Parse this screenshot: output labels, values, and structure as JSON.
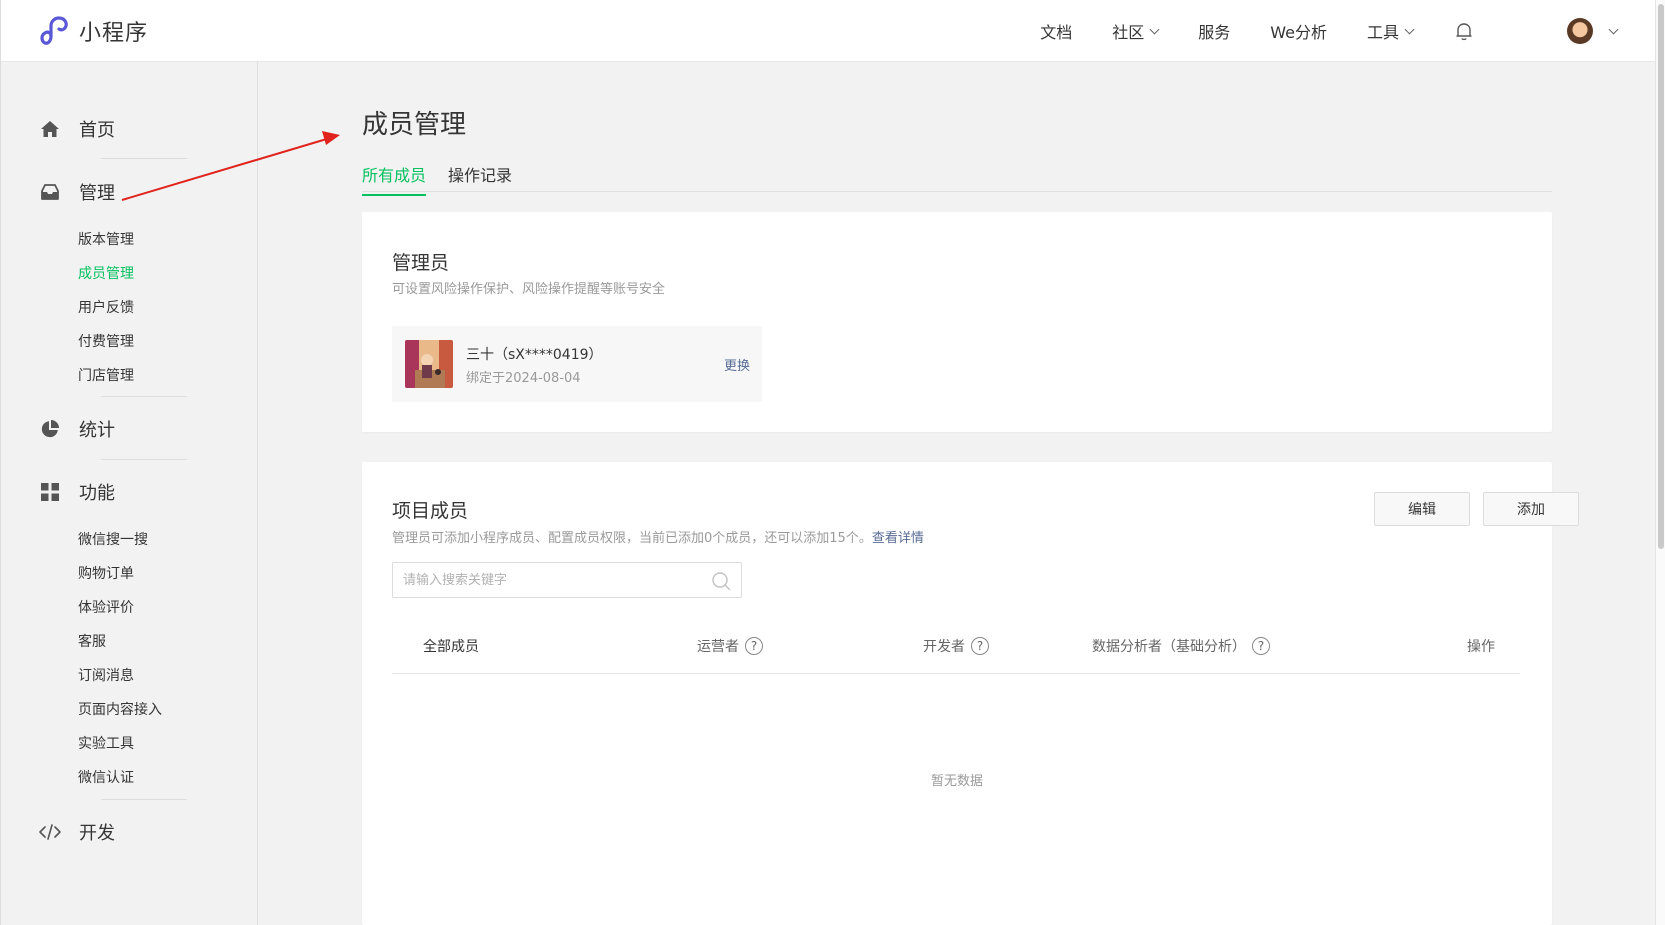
{
  "header": {
    "app_name": "小程序",
    "nav": [
      {
        "label": "文档",
        "dropdown": false
      },
      {
        "label": "社区",
        "dropdown": true
      },
      {
        "label": "服务",
        "dropdown": false
      },
      {
        "label": "We分析",
        "dropdown": false
      },
      {
        "label": "工具",
        "dropdown": true
      }
    ]
  },
  "sidebar": {
    "home": "首页",
    "manage": "管理",
    "manage_items": [
      "版本管理",
      "成员管理",
      "用户反馈",
      "付费管理",
      "门店管理"
    ],
    "stats": "统计",
    "features": "功能",
    "feature_items": [
      "微信搜一搜",
      "购物订单",
      "体验评价",
      "客服",
      "订阅消息",
      "页面内容接入",
      "实验工具",
      "微信认证"
    ],
    "dev": "开发",
    "active_item": "成员管理"
  },
  "main": {
    "title": "成员管理",
    "tabs": [
      "所有成员",
      "操作记录"
    ],
    "active_tab": "所有成员"
  },
  "admin_card": {
    "title": "管理员",
    "desc": "可设置风险操作保护、风险操作提醒等账号安全",
    "name": "三十（sX****0419）",
    "bound": "绑定于2024-08-04",
    "change": "更换"
  },
  "members_card": {
    "title": "项目成员",
    "desc": "管理员可添加小程序成员、配置成员权限，当前已添加0个成员，还可以添加15个。",
    "desc_link": "查看详情",
    "edit": "编辑",
    "add": "添加",
    "search_placeholder": "请输入搜索关键字",
    "columns": {
      "all": "全部成员",
      "operator": "运营者",
      "developer": "开发者",
      "analyst": "数据分析者（基础分析）",
      "action": "操作"
    },
    "empty": "暂无数据"
  },
  "colors": {
    "accent": "#07c160",
    "link": "#576b95",
    "annotation": "#e0231c"
  }
}
